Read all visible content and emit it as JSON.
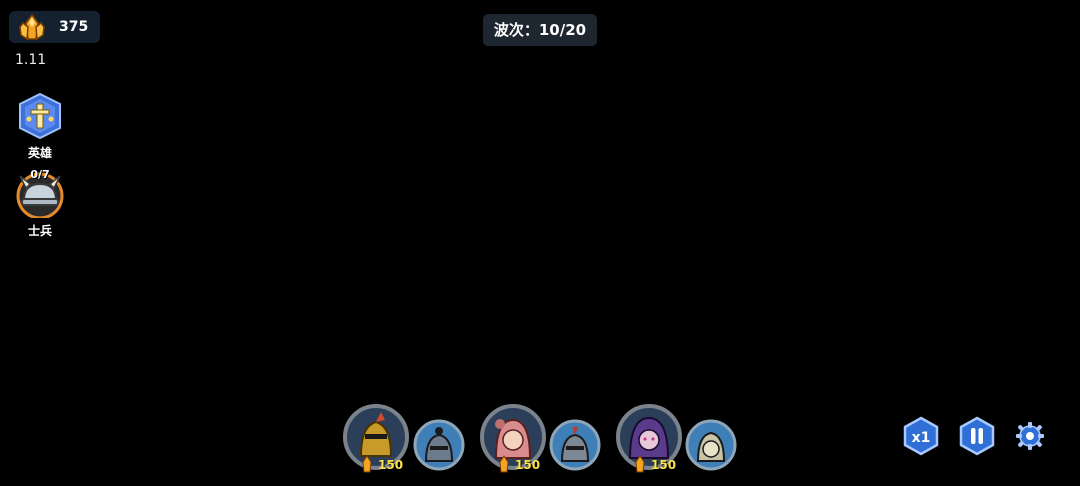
{
  "resource": {
    "amount": "375",
    "icon": "crystal-icon"
  },
  "version": "1.11",
  "wave": {
    "text": "波次：10/20"
  },
  "side": {
    "hero": {
      "label": "英雄",
      "icon": "hero-icon"
    },
    "soldier": {
      "label": "士兵",
      "count": "0/7",
      "icon": "helmet-icon"
    }
  },
  "units": [
    {
      "cost": "150"
    },
    {
      "cost": "150"
    },
    {
      "cost": "150"
    }
  ],
  "controls": {
    "speed_label": "x1"
  }
}
